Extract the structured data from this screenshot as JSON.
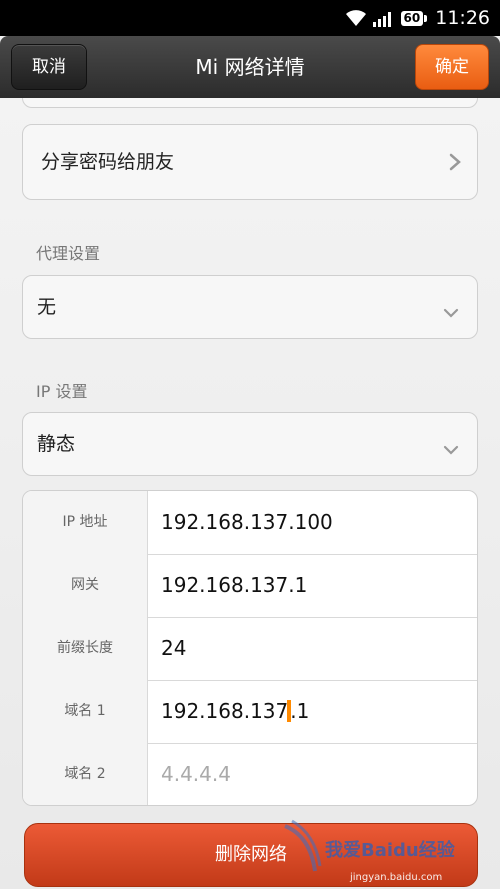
{
  "status_bar": {
    "battery": "60",
    "time": "11:26"
  },
  "header": {
    "cancel_label": "取消",
    "title": "Mi 网络详情",
    "confirm_label": "确定"
  },
  "share": {
    "label": "分享密码给朋友"
  },
  "proxy": {
    "section_label": "代理设置",
    "value": "无"
  },
  "ip": {
    "section_label": "IP 设置",
    "value": "静态"
  },
  "ip_fields": [
    {
      "label": "IP 地址",
      "value": "192.168.137.100",
      "placeholder": false
    },
    {
      "label": "网关",
      "value": "192.168.137.1",
      "placeholder": false
    },
    {
      "label": "前缀长度",
      "value": "24",
      "placeholder": false
    },
    {
      "label": "域名 1",
      "value_before_caret": "192.168.137",
      "value_after_caret": ".1",
      "placeholder": false
    },
    {
      "label": "域名 2",
      "value": "4.4.4.4",
      "placeholder": true
    }
  ],
  "delete_label": "删除网络",
  "watermark": {
    "text": "我爱Baidu经验",
    "url": "jingyan.baidu.com"
  },
  "colors": {
    "accent_orange": "#ef6a1f",
    "delete_red": "#d9482a",
    "caret": "#ff8a00"
  }
}
